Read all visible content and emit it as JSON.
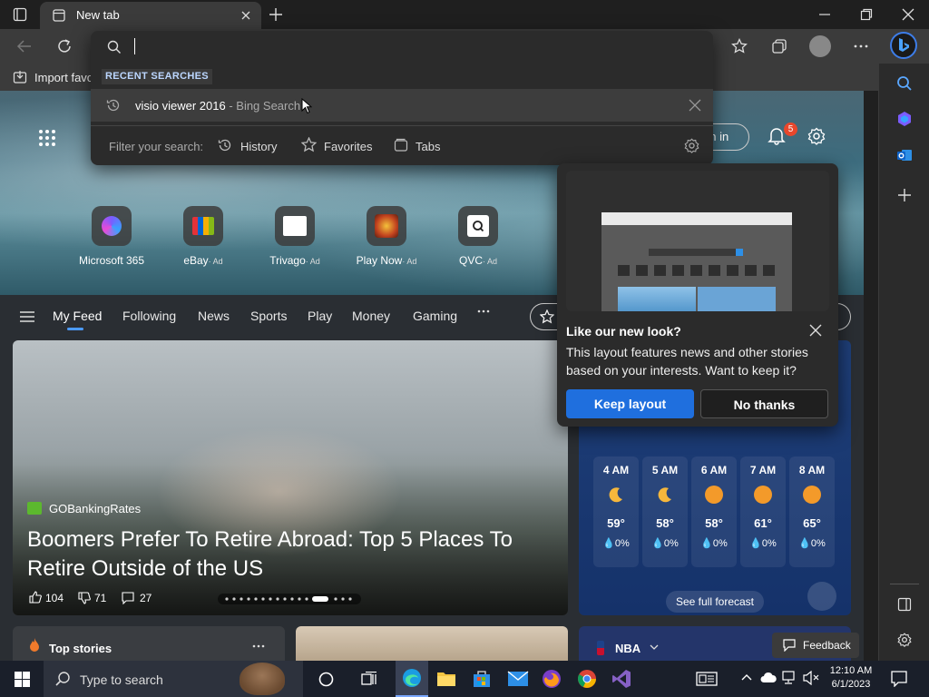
{
  "browser": {
    "tab_title": "New tab",
    "favorites_import": "Import favo"
  },
  "address_dropdown": {
    "recent_label": "RECENT SEARCHES",
    "recent_item": {
      "query": "visio viewer 2016",
      "suffix": " - Bing Search"
    },
    "filter_label": "Filter your search:",
    "filters": [
      "History",
      "Favorites",
      "Tabs"
    ]
  },
  "header": {
    "sign_in": "gn in",
    "notifications_badge": "5"
  },
  "quick_links": [
    {
      "label": "Microsoft 365",
      "ad": ""
    },
    {
      "label": "eBay",
      "ad": "· Ad"
    },
    {
      "label": "Trivago",
      "ad": "· Ad"
    },
    {
      "label": "Play Now",
      "ad": "· Ad"
    },
    {
      "label": "QVC",
      "ad": "· Ad"
    }
  ],
  "feed_nav": [
    "My Feed",
    "Following",
    "News",
    "Sports",
    "Play",
    "Money",
    "Gaming"
  ],
  "main_story": {
    "source": "GOBankingRates",
    "headline_line1": "Boomers Prefer To Retire Abroad: Top 5 Places To",
    "headline_line2": "Retire Outside of the US",
    "likes": "104",
    "dislikes": "71",
    "comments": "27"
  },
  "popup": {
    "title": "Like our new look?",
    "body": "This layout features news and other stories based on your interests. Want to keep it?",
    "keep": "Keep layout",
    "decline": "No thanks"
  },
  "weather": {
    "hours": [
      {
        "time": "4 AM",
        "temp": "59°",
        "precip": "0%",
        "icon": "moon"
      },
      {
        "time": "5 AM",
        "temp": "58°",
        "precip": "0%",
        "icon": "moon"
      },
      {
        "time": "6 AM",
        "temp": "58°",
        "precip": "0%",
        "icon": "sun"
      },
      {
        "time": "7 AM",
        "temp": "61°",
        "precip": "0%",
        "icon": "sun"
      },
      {
        "time": "8 AM",
        "temp": "65°",
        "precip": "0%",
        "icon": "sun"
      }
    ],
    "see_forecast": "See full forecast"
  },
  "bottom": {
    "top_stories": "Top stories",
    "nba": "NBA",
    "feedback": "Feedback"
  },
  "taskbar": {
    "search_placeholder": "Type to search",
    "time": "12:10 AM",
    "date": "6/1/2023"
  },
  "colors": {
    "accent": "#1f6fde",
    "keep_button": "#1f6fde",
    "weather_bg": "#1f3f79"
  }
}
